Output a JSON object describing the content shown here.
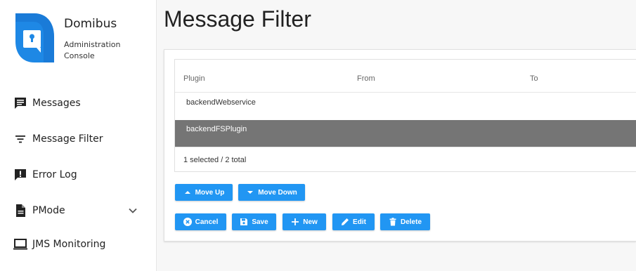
{
  "app": {
    "name": "Domibus",
    "subtitle": "Administration Console",
    "brand_color": "#1e88e5"
  },
  "sidebar": {
    "items": [
      {
        "label": "Messages",
        "icon": "message-icon"
      },
      {
        "label": "Message Filter",
        "icon": "filter-icon"
      },
      {
        "label": "Error Log",
        "icon": "error-log-icon"
      },
      {
        "label": "PMode",
        "icon": "document-icon",
        "expandable": true
      },
      {
        "label": "JMS Monitoring",
        "icon": "monitor-icon"
      }
    ]
  },
  "page": {
    "title": "Message Filter"
  },
  "table": {
    "columns": [
      "Plugin",
      "From",
      "To"
    ],
    "rows": [
      {
        "plugin": "backendWebservice",
        "from": "",
        "to": "",
        "selected": false
      },
      {
        "plugin": "backendFSPlugin",
        "from": "",
        "to": "",
        "selected": true
      }
    ],
    "footer": "1 selected / 2 total",
    "selected_color": "#757575"
  },
  "buttons": {
    "move_up": "Move Up",
    "move_down": "Move Down",
    "cancel": "Cancel",
    "save": "Save",
    "new": "New",
    "edit": "Edit",
    "delete": "Delete",
    "color": "#2196f3"
  }
}
